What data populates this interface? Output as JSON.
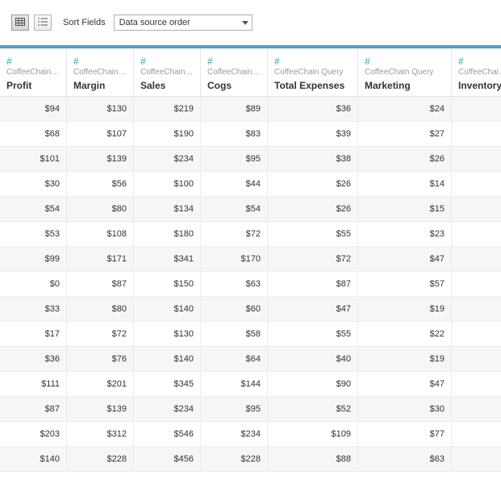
{
  "toolbar": {
    "sort_label": "Sort Fields",
    "sort_value": "Data source order"
  },
  "columns": [
    {
      "source": "CoffeeChain …",
      "name": "Profit"
    },
    {
      "source": "CoffeeChain Qu…",
      "name": "Margin"
    },
    {
      "source": "CoffeeChain …",
      "name": "Sales"
    },
    {
      "source": "CoffeeChain …",
      "name": "Cogs"
    },
    {
      "source": "CoffeeChain Query",
      "name": "Total Expenses"
    },
    {
      "source": "CoffeeChain Query",
      "name": "Marketing"
    },
    {
      "source": "CoffeeChain Q",
      "name": "Inventory"
    }
  ],
  "rows": [
    [
      "$94",
      "$130",
      "$219",
      "$89",
      "$36",
      "$24",
      ""
    ],
    [
      "$68",
      "$107",
      "$190",
      "$83",
      "$39",
      "$27",
      ""
    ],
    [
      "$101",
      "$139",
      "$234",
      "$95",
      "$38",
      "$26",
      ""
    ],
    [
      "$30",
      "$56",
      "$100",
      "$44",
      "$26",
      "$14",
      ""
    ],
    [
      "$54",
      "$80",
      "$134",
      "$54",
      "$26",
      "$15",
      ""
    ],
    [
      "$53",
      "$108",
      "$180",
      "$72",
      "$55",
      "$23",
      ""
    ],
    [
      "$99",
      "$171",
      "$341",
      "$170",
      "$72",
      "$47",
      ""
    ],
    [
      "$0",
      "$87",
      "$150",
      "$63",
      "$87",
      "$57",
      ""
    ],
    [
      "$33",
      "$80",
      "$140",
      "$60",
      "$47",
      "$19",
      ""
    ],
    [
      "$17",
      "$72",
      "$130",
      "$58",
      "$55",
      "$22",
      ""
    ],
    [
      "$36",
      "$76",
      "$140",
      "$64",
      "$40",
      "$19",
      ""
    ],
    [
      "$111",
      "$201",
      "$345",
      "$144",
      "$90",
      "$47",
      ""
    ],
    [
      "$87",
      "$139",
      "$234",
      "$95",
      "$52",
      "$30",
      ""
    ],
    [
      "$203",
      "$312",
      "$546",
      "$234",
      "$109",
      "$77",
      ""
    ],
    [
      "$140",
      "$228",
      "$456",
      "$228",
      "$88",
      "$63",
      ""
    ]
  ],
  "chart_data": {
    "type": "table",
    "columns": [
      "Profit",
      "Margin",
      "Sales",
      "Cogs",
      "Total Expenses",
      "Marketing"
    ],
    "rows": [
      [
        94,
        130,
        219,
        89,
        36,
        24
      ],
      [
        68,
        107,
        190,
        83,
        39,
        27
      ],
      [
        101,
        139,
        234,
        95,
        38,
        26
      ],
      [
        30,
        56,
        100,
        44,
        26,
        14
      ],
      [
        54,
        80,
        134,
        54,
        26,
        15
      ],
      [
        53,
        108,
        180,
        72,
        55,
        23
      ],
      [
        99,
        171,
        341,
        170,
        72,
        47
      ],
      [
        0,
        87,
        150,
        63,
        87,
        57
      ],
      [
        33,
        80,
        140,
        60,
        47,
        19
      ],
      [
        17,
        72,
        130,
        58,
        55,
        22
      ],
      [
        36,
        76,
        140,
        64,
        40,
        19
      ],
      [
        111,
        201,
        345,
        144,
        90,
        47
      ],
      [
        87,
        139,
        234,
        95,
        52,
        30
      ],
      [
        203,
        312,
        546,
        234,
        109,
        77
      ],
      [
        140,
        228,
        456,
        228,
        88,
        63
      ]
    ]
  }
}
